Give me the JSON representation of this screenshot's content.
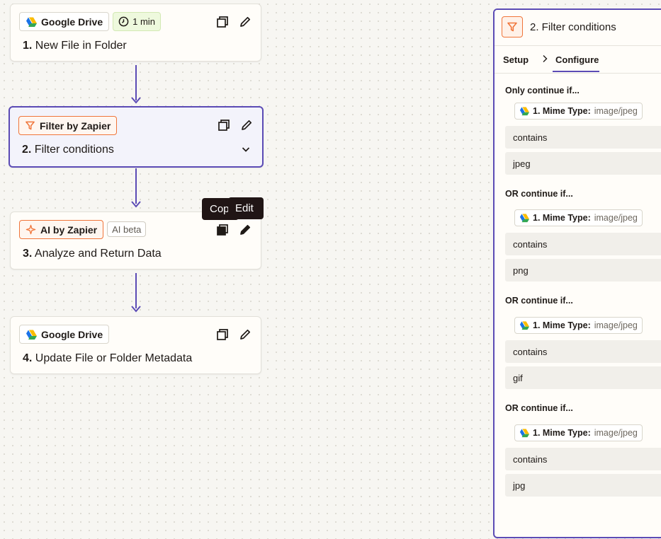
{
  "steps": [
    {
      "app": "Google Drive",
      "badge": "1 min",
      "number": "1.",
      "title": "New File in Folder"
    },
    {
      "app": "Filter by Zapier",
      "number": "2.",
      "title": "Filter conditions"
    },
    {
      "app": "AI by Zapier",
      "badge": "AI beta",
      "number": "3.",
      "title": "Analyze and Return Data"
    },
    {
      "app": "Google Drive",
      "number": "4.",
      "title": "Update File or Folder Metadata"
    }
  ],
  "tooltips": {
    "copy": "Copy",
    "edit": "Edit"
  },
  "panel": {
    "title": "2. Filter conditions",
    "tabs": {
      "setup": "Setup",
      "configure": "Configure"
    },
    "groups": [
      {
        "label": "Only continue if...",
        "field_name": "1. Mime Type:",
        "field_value": "image/jpeg",
        "operator": "contains",
        "value": "jpeg"
      },
      {
        "label": "OR continue if...",
        "field_name": "1. Mime Type:",
        "field_value": "image/jpeg",
        "operator": "contains",
        "value": "png"
      },
      {
        "label": "OR continue if...",
        "field_name": "1. Mime Type:",
        "field_value": "image/jpeg",
        "operator": "contains",
        "value": "gif"
      },
      {
        "label": "OR continue if...",
        "field_name": "1. Mime Type:",
        "field_value": "image/jpeg",
        "operator": "contains",
        "value": "jpg"
      }
    ]
  },
  "colors": {
    "accent": "#5b4bb5",
    "zapier_orange": "#f0753a",
    "tooltip_bg": "#201515"
  },
  "icons": [
    "google-drive-icon",
    "clock-icon",
    "filter-icon",
    "ai-sparkle-icon",
    "copy-icon",
    "edit-icon",
    "chevron-down-icon",
    "chevron-right-icon"
  ]
}
